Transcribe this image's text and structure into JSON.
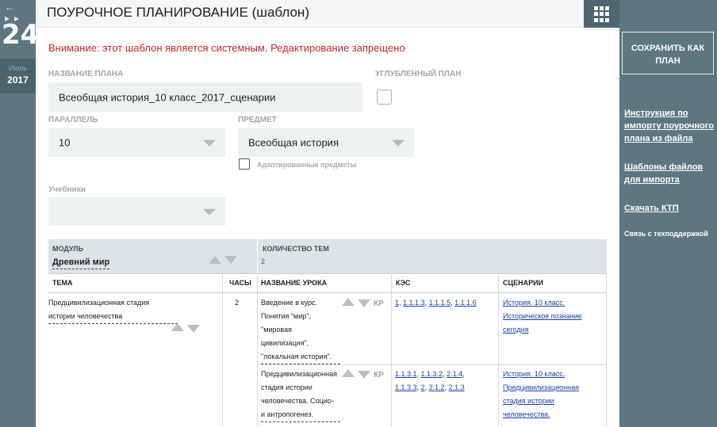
{
  "date": {
    "nav": "← ▸▸",
    "day": "24",
    "month": "Июль",
    "year": "2017"
  },
  "header": {
    "title": "ПОУРОЧНОЕ ПЛАНИРОВАНИЕ (шаблон)",
    "menu_icon": "grid-icon"
  },
  "warning": "Внимание: этот шаблон является системным. Редактирование запрещено",
  "form": {
    "plan_name_label": "НАЗВАНИЕ ПЛАНА",
    "plan_name_value": "Всеобщая история_10 класс_2017_сценарии",
    "deep_plan_label": "УГЛУБЛЕННЫЙ ПЛАН",
    "parallel_label": "ПАРАЛЛЕЛЬ",
    "parallel_value": "10",
    "subject_label": "ПРЕДМЕТ",
    "subject_value": "Всеобщая история",
    "adapted_label": "Адаптированные предметы",
    "textbooks_label": "Учебники",
    "textbooks_value": ""
  },
  "table": {
    "module_label": "МОДУЛЬ",
    "module_value": "Древний мир",
    "count_label": "КОЛИЧЕСТВО ТЕМ",
    "count_value": "2",
    "columns": [
      "ТЕМА",
      "ЧАСЫ",
      "НАЗВАНИЕ УРОКА",
      "КЭС",
      "СЦЕНАРИИ"
    ],
    "topic": {
      "lines": [
        "Предцивилизационная стадия",
        "истории человечества"
      ],
      "hours": "2"
    },
    "lessons": [
      {
        "lines": [
          "Введение в курс.",
          "Понятия \"мир\",",
          "\"мировая",
          "цивилизация\",",
          "\"локальная история\"."
        ],
        "kp": "КР",
        "kes_lines": [
          [
            "1",
            "1.1.1.3",
            "1.1.1.5",
            "1.1.1.6"
          ]
        ],
        "scenario_lines": [
          "История. 10 класс.",
          "Историческое познание",
          "сегодня"
        ]
      },
      {
        "lines": [
          "Предцивилизационная",
          "стадия истории",
          "человечества. Социо-",
          "и антропогенез."
        ],
        "kp": "КР",
        "kes_lines": [
          [
            "1.1.3.1",
            "1.1.3.2",
            "2.1.4"
          ],
          [
            "1.1.3.3",
            "2",
            "2.1.2",
            "2.1.3"
          ]
        ],
        "scenario_lines": [
          "История. 10 класс.",
          "Предцивилизационная",
          "стадия истории",
          "человечества."
        ]
      }
    ]
  },
  "sidebar": {
    "save_button": "СОХРАНИТЬ КАК ПЛАН",
    "link_import": "Инструкция по импорту поурочного плана из файла",
    "link_templates": "Шаблоны файлов для импорта",
    "link_download": "Скачать КТП",
    "support": "Связь с техподдержкой"
  }
}
